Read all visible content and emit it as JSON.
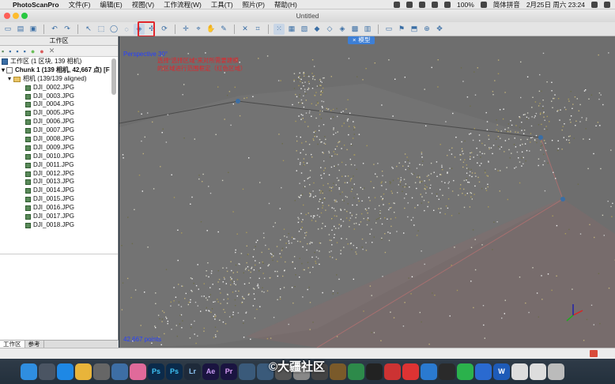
{
  "menubar": {
    "app_name": "PhotoScanPro",
    "menus": [
      "文件(F)",
      "编辑(E)",
      "视图(V)",
      "工作流程(W)",
      "工具(T)",
      "照片(P)",
      "帮助(H)"
    ],
    "battery": "100%",
    "ime": "简体拼音",
    "datetime": "2月25日 周六  23:24"
  },
  "window": {
    "title": "Untitled"
  },
  "workspace": {
    "title": "工作区",
    "root_label": "工作区 (1 区块, 139 相机)",
    "chunk_label": "Chunk 1 (139 相机, 42,667 点) [F",
    "cameras_label": "相机 (139/139 aligned)",
    "photos": [
      "DJI_0002.JPG",
      "DJI_0003.JPG",
      "DJI_0004.JPG",
      "DJI_0005.JPG",
      "DJI_0006.JPG",
      "DJI_0007.JPG",
      "DJI_0008.JPG",
      "DJI_0009.JPG",
      "DJI_0010.JPG",
      "DJI_0011.JPG",
      "DJI_0012.JPG",
      "DJI_0013.JPG",
      "DJI_0014.JPG",
      "DJI_0015.JPG",
      "DJI_0016.JPG",
      "DJI_0017.JPG",
      "DJI_0018.JPG"
    ],
    "tab_workspace": "工作区",
    "tab_reference": "参考"
  },
  "viewport": {
    "tab_label": "模型",
    "projection": "Perspective 30°",
    "points": "42,667 points",
    "annotation": "选择\"选择区域\"来对所需要建模的区域进行范围框定（红色区域）"
  },
  "watermark": "©大疆社区",
  "colors": {
    "accent": "#3d7fd6",
    "highlight": "#e0262c",
    "label_blue": "#2540ff"
  }
}
